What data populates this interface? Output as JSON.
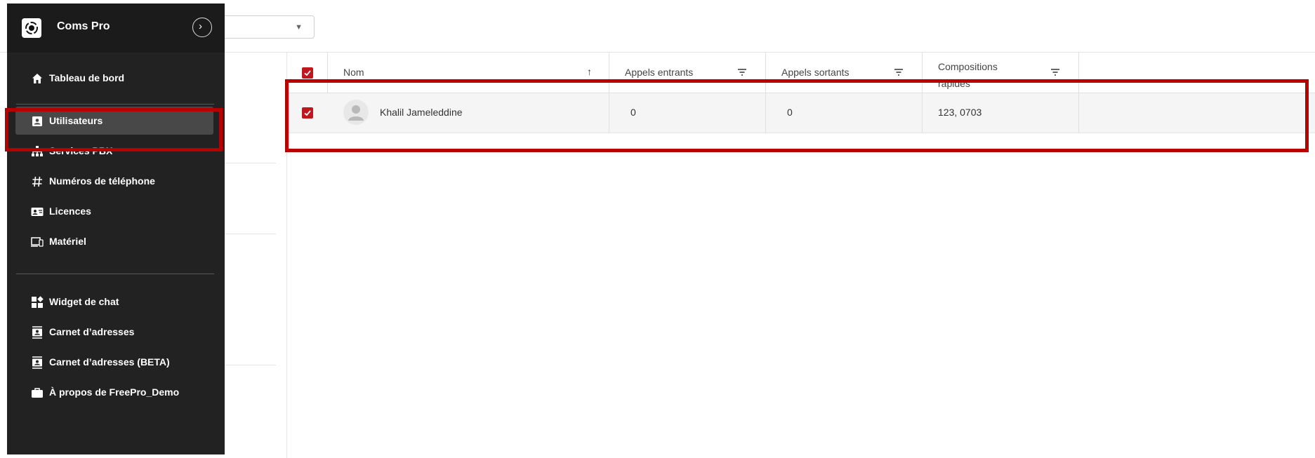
{
  "app": {
    "name": "Coms Pro"
  },
  "sidebar": {
    "items": [
      {
        "label": "Tableau de bord",
        "icon": "home-icon"
      },
      {
        "label": "Utilisateurs",
        "icon": "user-card-icon",
        "active": true
      },
      {
        "label": "Services PBX",
        "icon": "sitemap-icon"
      },
      {
        "label": "Numéros de téléphone",
        "icon": "hash-icon"
      },
      {
        "label": "Licences",
        "icon": "license-card-icon"
      },
      {
        "label": "Matériel",
        "icon": "devices-icon"
      },
      {
        "label": "Widget de chat",
        "icon": "widgets-icon"
      },
      {
        "label": "Carnet d’adresses",
        "icon": "contacts-icon"
      },
      {
        "label": "Carnet d’adresses (BETA)",
        "icon": "contacts-icon"
      },
      {
        "label": "À propos de FreePro_Demo",
        "icon": "briefcase-icon"
      }
    ]
  },
  "table": {
    "columns": [
      {
        "label": "Nom",
        "icon": "sort-up-icon"
      },
      {
        "label": "Appels entrants",
        "icon": "filter-icon"
      },
      {
        "label": "Appels sortants",
        "icon": "filter-icon"
      },
      {
        "label": "Compositions rapides",
        "icon": "filter-icon"
      }
    ],
    "rows": [
      {
        "name": "Khalil Jameleddine",
        "incoming": "0",
        "outgoing": "0",
        "speed_dials": "123, 0703",
        "checked": true
      }
    ]
  },
  "colors": {
    "accent": "#c0161e",
    "highlight": "#b70000",
    "sidebar_bg": "#222222"
  }
}
